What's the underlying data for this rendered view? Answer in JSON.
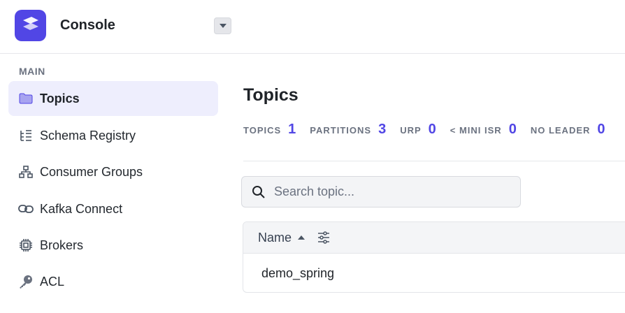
{
  "header": {
    "app_title": "Console",
    "logo_icon": "stack-layers-icon",
    "cluster_dropdown_icon": "caret-down-icon"
  },
  "sidebar": {
    "section_label": "MAIN",
    "items": [
      {
        "label": "Topics",
        "icon": "folder-icon",
        "active": true
      },
      {
        "label": "Schema Registry",
        "icon": "tree-list-icon",
        "active": false
      },
      {
        "label": "Consumer Groups",
        "icon": "hierarchy-icon",
        "active": false
      },
      {
        "label": "Kafka Connect",
        "icon": "link-icon",
        "active": false
      },
      {
        "label": "Brokers",
        "icon": "chip-icon",
        "active": false
      },
      {
        "label": "ACL",
        "icon": "key-icon",
        "active": false
      }
    ]
  },
  "main": {
    "page_title": "Topics",
    "stats": [
      {
        "label": "TOPICS",
        "value": "1"
      },
      {
        "label": "PARTITIONS",
        "value": "3"
      },
      {
        "label": "URP",
        "value": "0"
      },
      {
        "label": "< MINI ISR",
        "value": "0"
      },
      {
        "label": "NO LEADER",
        "value": "0"
      }
    ],
    "search": {
      "placeholder": "Search topic...",
      "value": ""
    },
    "table": {
      "columns": [
        {
          "label": "Name",
          "sort": "ascending"
        }
      ],
      "rows": [
        {
          "name": "demo_spring"
        }
      ]
    }
  },
  "colors": {
    "accent": "#5146e5",
    "active_nav_bg": "#eeeefd",
    "muted_text": "#6b7280"
  }
}
